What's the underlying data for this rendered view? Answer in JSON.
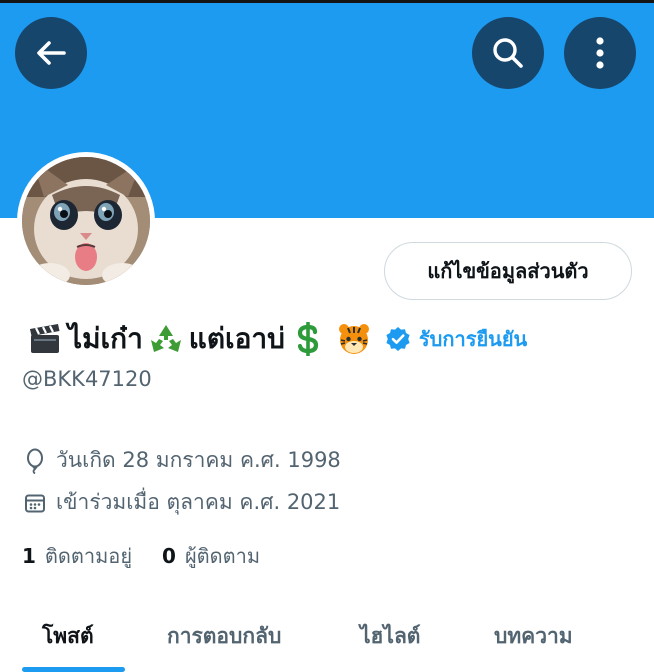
{
  "header": {
    "back_icon": "arrow-left-icon",
    "search_icon": "search-icon",
    "more_icon": "more-vertical-icon",
    "banner_color": "#1d9bf0"
  },
  "profile": {
    "edit_profile_label": "แก้ไขข้อมูลส่วนตัว",
    "name_part1": "ไม่เก๋า",
    "name_part2": "แต่เอาบ่",
    "emojis": [
      "clapper-board",
      "recycle",
      "dollar",
      "tiger"
    ],
    "verified_label": "รับการยืนยัน",
    "handle": "@BKK47120",
    "birth_date": "วันเกิด 28 มกราคม ค.ศ. 1998",
    "joined_date": "เข้าร่วมเมื่อ ตุลาคม ค.ศ. 2021"
  },
  "stats": {
    "following_count": "1",
    "following_label": "ติดตามอยู่",
    "followers_count": "0",
    "followers_label": "ผู้ติดตาม"
  },
  "tabs": [
    {
      "label": "โพสต์",
      "active": true
    },
    {
      "label": "การตอบกลับ",
      "active": false
    },
    {
      "label": "ไฮไลต์",
      "active": false
    },
    {
      "label": "บทความ",
      "active": false
    }
  ],
  "colors": {
    "accent": "#1d9bf0",
    "text_primary": "#0f1419",
    "text_secondary": "#536471"
  }
}
